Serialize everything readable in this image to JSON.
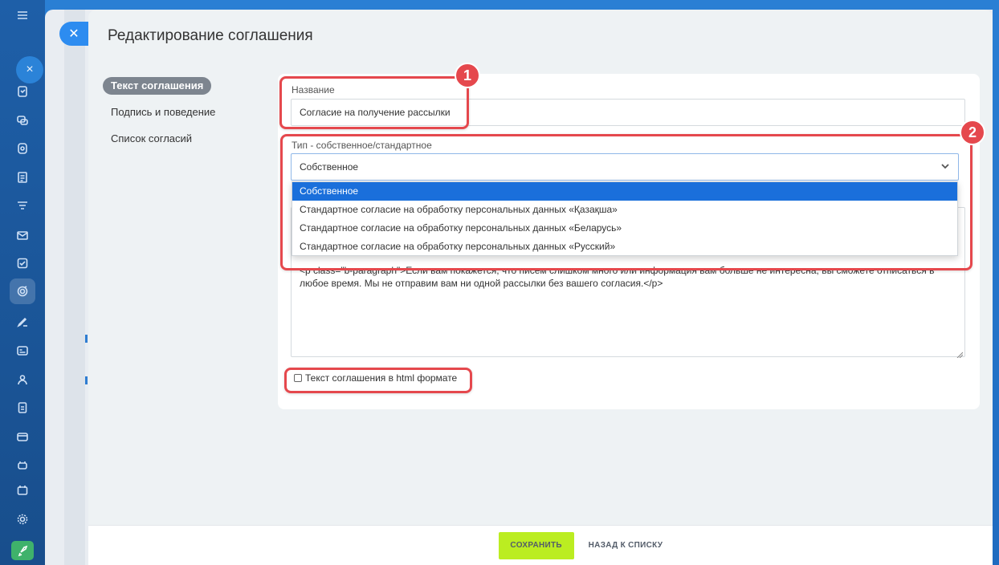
{
  "panel": {
    "title": "Редактирование соглашения"
  },
  "menu": {
    "items": [
      {
        "label": "Текст соглашения",
        "active": true
      },
      {
        "label": "Подпись и поведение",
        "active": false
      },
      {
        "label": "Список согласий",
        "active": false
      }
    ]
  },
  "form": {
    "name_label": "Название",
    "name_value": "Согласие на получение рассылки",
    "type_label": "Тип - собственное/стандартное",
    "type_value": "Собственное",
    "type_options": [
      "Собственное",
      "Стандартное согласие на обработку персональных данных «Қазақша»",
      "Стандартное согласие на обработку персональных данных «Беларусь»",
      "Стандартное согласие на обработку персональных данных «Русский»"
    ],
    "text_line1": "<p class=\"b-paragraph\">Если вам покажется, что писем слишком много или информация вам больше не интересна, вы сможете отписаться в",
    "text_line2": "любое время. Мы не отправим вам ни одной рассылки без вашего согласия.</p>",
    "html_checkbox_label": "Текст соглашения в html формате",
    "html_checkbox_checked": false
  },
  "annotations": {
    "badge1": "1",
    "badge2": "2",
    "highlight_color": "#e5484d"
  },
  "footer": {
    "save_label": "СОХРАНИТЬ",
    "back_label": "НАЗАД К СПИСКУ"
  },
  "colors": {
    "save_button": "#bbed21",
    "selected_option": "#1a6fdb",
    "rail": "#1e5fa8"
  }
}
